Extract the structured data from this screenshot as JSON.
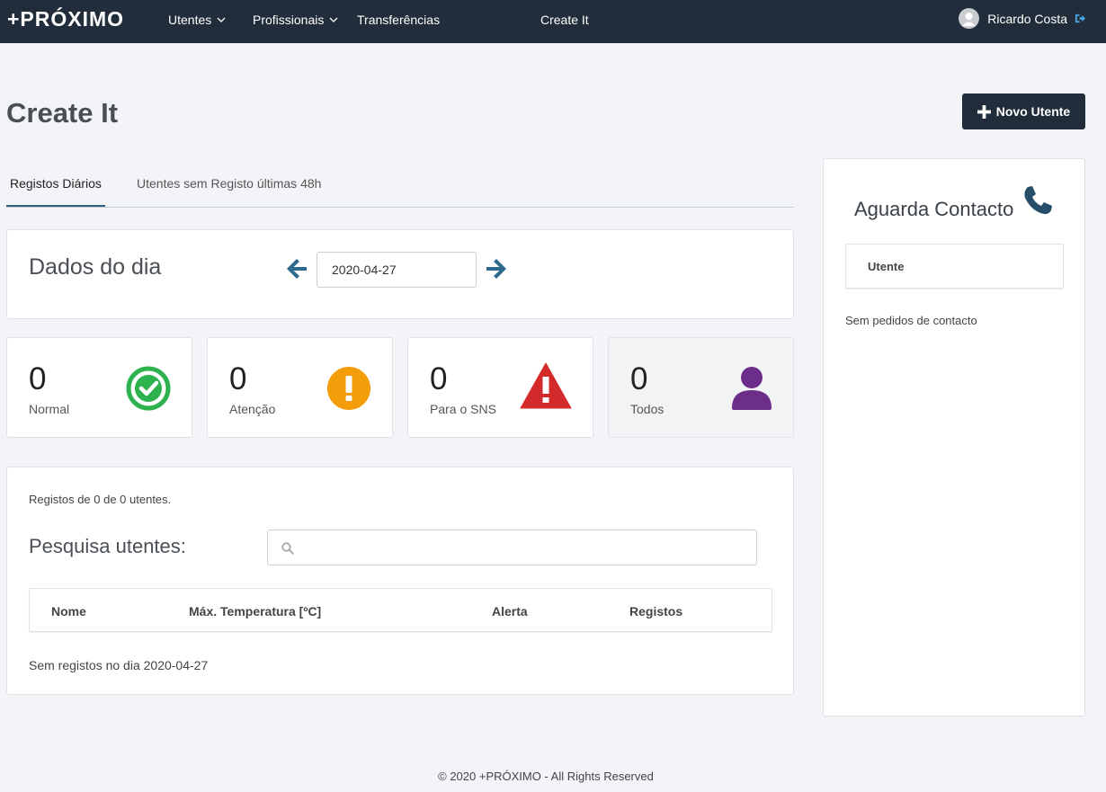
{
  "navbar": {
    "brand": "+PRÓXIMO",
    "items": [
      {
        "label": "Utentes"
      },
      {
        "label": "Profissionais"
      },
      {
        "label": "Transferências"
      },
      {
        "label": "Create It"
      }
    ],
    "user_name": "Ricardo Costa"
  },
  "header": {
    "title": "Create It",
    "new_button_label": "Novo Utente"
  },
  "tabs": [
    {
      "label": "Registos Diários",
      "active": true
    },
    {
      "label": "Utentes sem Registo últimas 48h",
      "active": false
    }
  ],
  "dados": {
    "title": "Dados do dia",
    "date_value": "2020-04-27"
  },
  "stats": [
    {
      "value": "0",
      "label": "Normal",
      "icon": "check-circle-icon",
      "color": "#2eb24e"
    },
    {
      "value": "0",
      "label": "Atenção",
      "icon": "exclamation-circle-icon",
      "color": "#f49c0a"
    },
    {
      "value": "0",
      "label": "Para o SNS",
      "icon": "warning-triangle-icon",
      "color": "#d32b2b"
    },
    {
      "value": "0",
      "label": "Todos",
      "icon": "user-icon",
      "color": "#6b2f8a"
    }
  ],
  "registos": {
    "count_text": "Registos de 0 de 0 utentes.",
    "search_label": "Pesquisa utentes:",
    "search_value": "",
    "columns": [
      "Nome",
      "Máx. Temperatura [ºC]",
      "Alerta",
      "Registos"
    ],
    "empty_message": "Sem registos no dia 2020-04-27"
  },
  "sidebar": {
    "title": "Aguarda Contacto",
    "column": "Utente",
    "empty_message": "Sem pedidos de contacto"
  },
  "footer": {
    "text": "© 2020 +PRÓXIMO - All Rights Reserved"
  },
  "colors": {
    "navbar": "#212d3a",
    "accent": "#2e5e80"
  }
}
